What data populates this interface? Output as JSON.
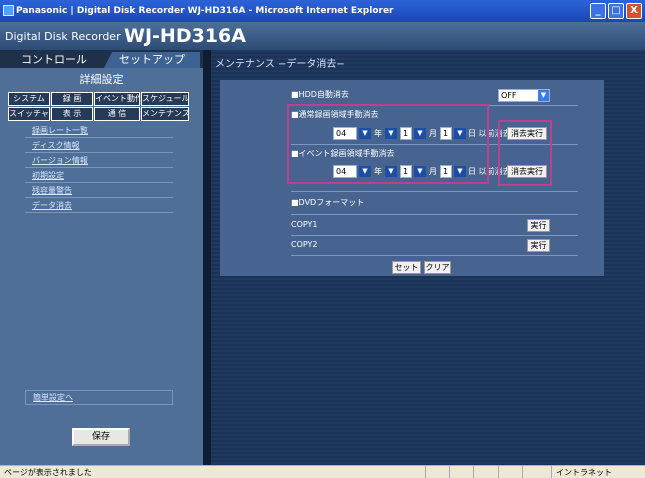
{
  "window": {
    "title": "Panasonic | Digital Disk Recorder WJ-HD316A - Microsoft Internet Explorer",
    "min": "_",
    "max": "□",
    "close": "X"
  },
  "brand": {
    "prefix": "Digital Disk Recorder",
    "model": "WJ-HD316A"
  },
  "tabs": [
    {
      "label": "コントロール"
    },
    {
      "label": "セットアップ"
    }
  ],
  "sidebar": {
    "title": "詳細設定",
    "buttons_row1": [
      "システム",
      "録 画",
      "イベント動作",
      "スケジュール"
    ],
    "buttons_row2": [
      "スイッチャー",
      "表 示",
      "通 信",
      "メンテナンス"
    ],
    "menu": [
      "録画レート一覧",
      "ディスク情報",
      "バージョン情報",
      "初期設定",
      "残容量警告",
      "データ消去"
    ],
    "quick": "簡単設定へ",
    "save": "保存"
  },
  "main": {
    "title": "メンテナンス −データ消去−",
    "hdd_auto_delete": {
      "label": "■HDD自動消去",
      "value": "OFF"
    },
    "normal": {
      "label": "■通常録画領域手動消去",
      "year": "04",
      "month": "1",
      "day": "1",
      "year_unit": "年",
      "month_unit": "月",
      "day_unit": "日 以前消去",
      "button": "消去実行"
    },
    "event": {
      "label": "■イベント録画領域手動消去",
      "year": "04",
      "month": "1",
      "day": "1",
      "year_unit": "年",
      "month_unit": "月",
      "day_unit": "日 以前消去",
      "button": "消去実行"
    },
    "dvd": {
      "label": "■DVDフォーマット",
      "copy1": "COPY1",
      "copy2": "COPY2",
      "exec": "実行"
    },
    "set": "セット",
    "clear": "クリア"
  },
  "status": {
    "left": "ページが表示されました",
    "zone": "イントラネット"
  },
  "colors": {
    "highlight": "#c13d8f",
    "panel": "#46648f",
    "sidebar": "#4f6f99"
  }
}
